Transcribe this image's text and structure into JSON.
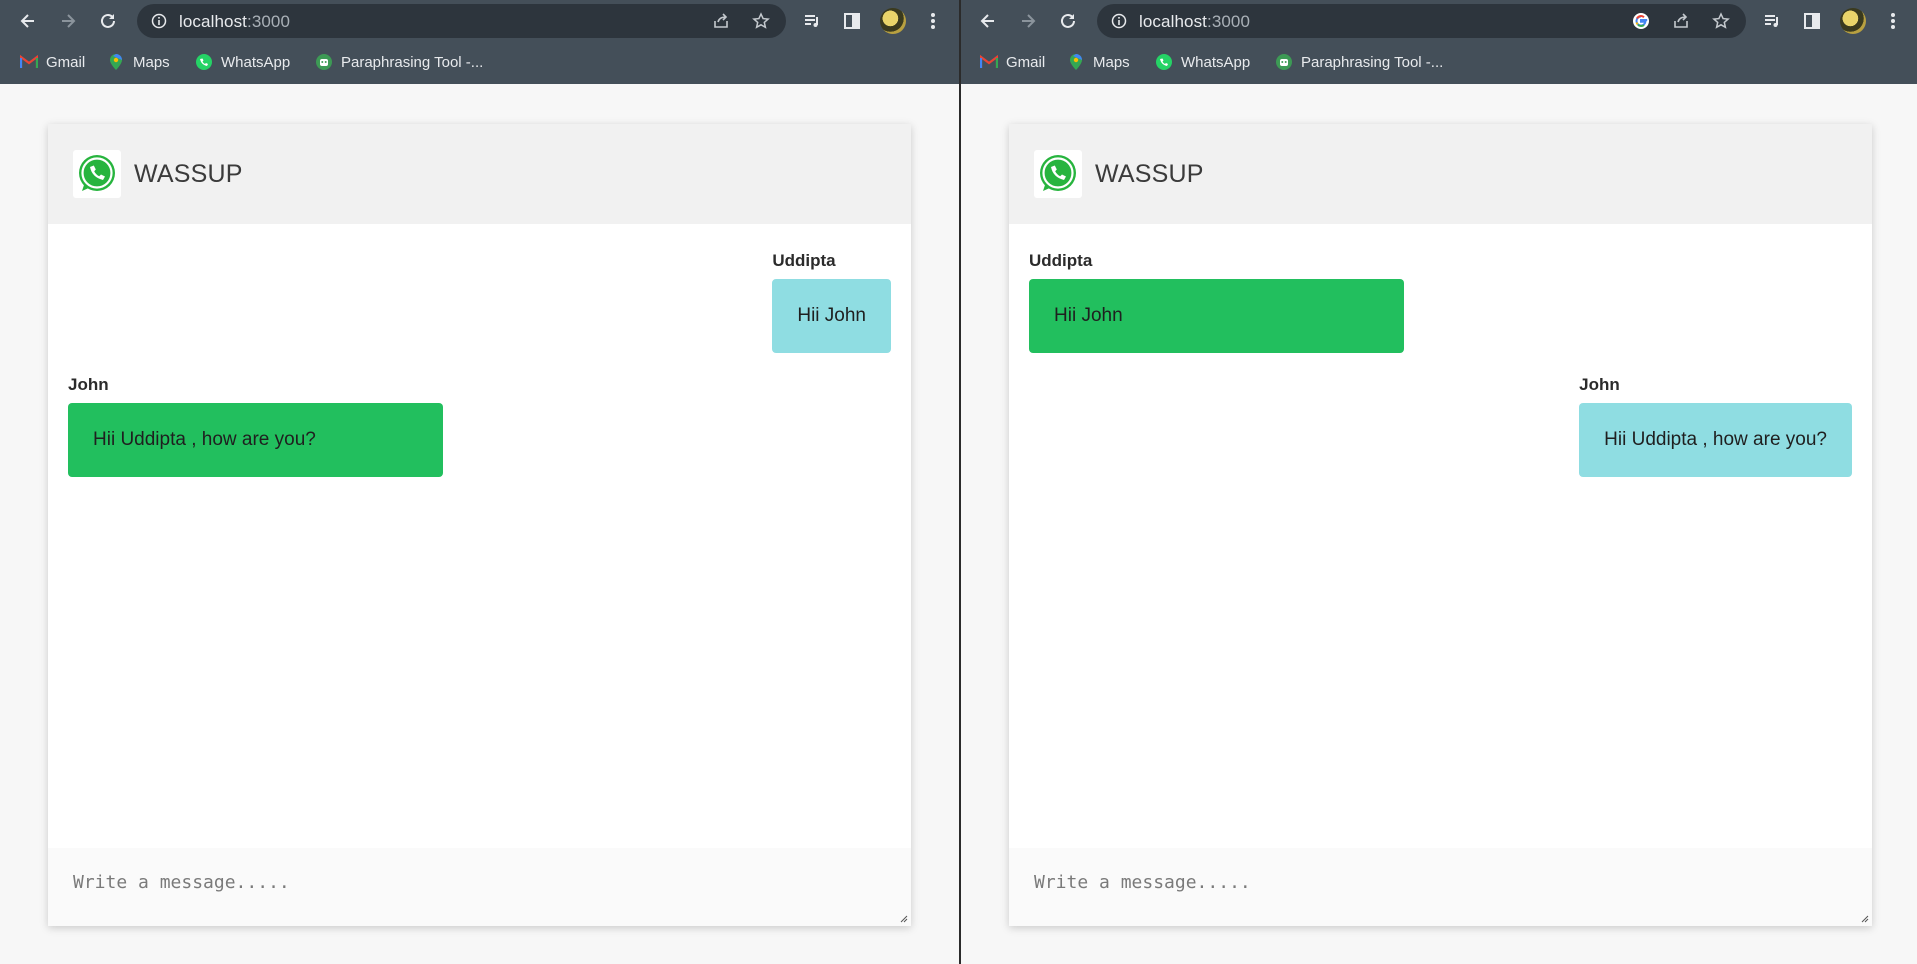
{
  "windows": [
    {
      "browser": {
        "url_host": "localhost",
        "url_port": ":3000",
        "bookmarks": [
          {
            "label": "Gmail",
            "icon": "gmail-icon"
          },
          {
            "label": "Maps",
            "icon": "maps-icon"
          },
          {
            "label": "WhatsApp",
            "icon": "whatsapp-icon"
          },
          {
            "label": "Paraphrasing Tool -...",
            "icon": "robot-icon"
          }
        ]
      },
      "app": {
        "title": "WASSUP",
        "messages": [
          {
            "sender": "Uddipta",
            "text": "Hii John",
            "align": "right",
            "color": "#8fdde2"
          },
          {
            "sender": "John",
            "text": "Hii Uddipta , how are you?",
            "align": "left",
            "color": "#22bf5e"
          }
        ],
        "composer_placeholder": "Write a message....."
      }
    },
    {
      "browser": {
        "url_host": "localhost",
        "url_port": ":3000",
        "bookmarks": [
          {
            "label": "Gmail",
            "icon": "gmail-icon"
          },
          {
            "label": "Maps",
            "icon": "maps-icon"
          },
          {
            "label": "WhatsApp",
            "icon": "whatsapp-icon"
          },
          {
            "label": "Paraphrasing Tool -...",
            "icon": "robot-icon"
          }
        ]
      },
      "app": {
        "title": "WASSUP",
        "messages": [
          {
            "sender": "Uddipta",
            "text": "Hii John",
            "align": "left",
            "color": "#22bf5e"
          },
          {
            "sender": "John",
            "text": "Hii Uddipta , how are you?",
            "align": "right",
            "color": "#8fdde2"
          }
        ],
        "composer_placeholder": "Write a message....."
      }
    }
  ]
}
